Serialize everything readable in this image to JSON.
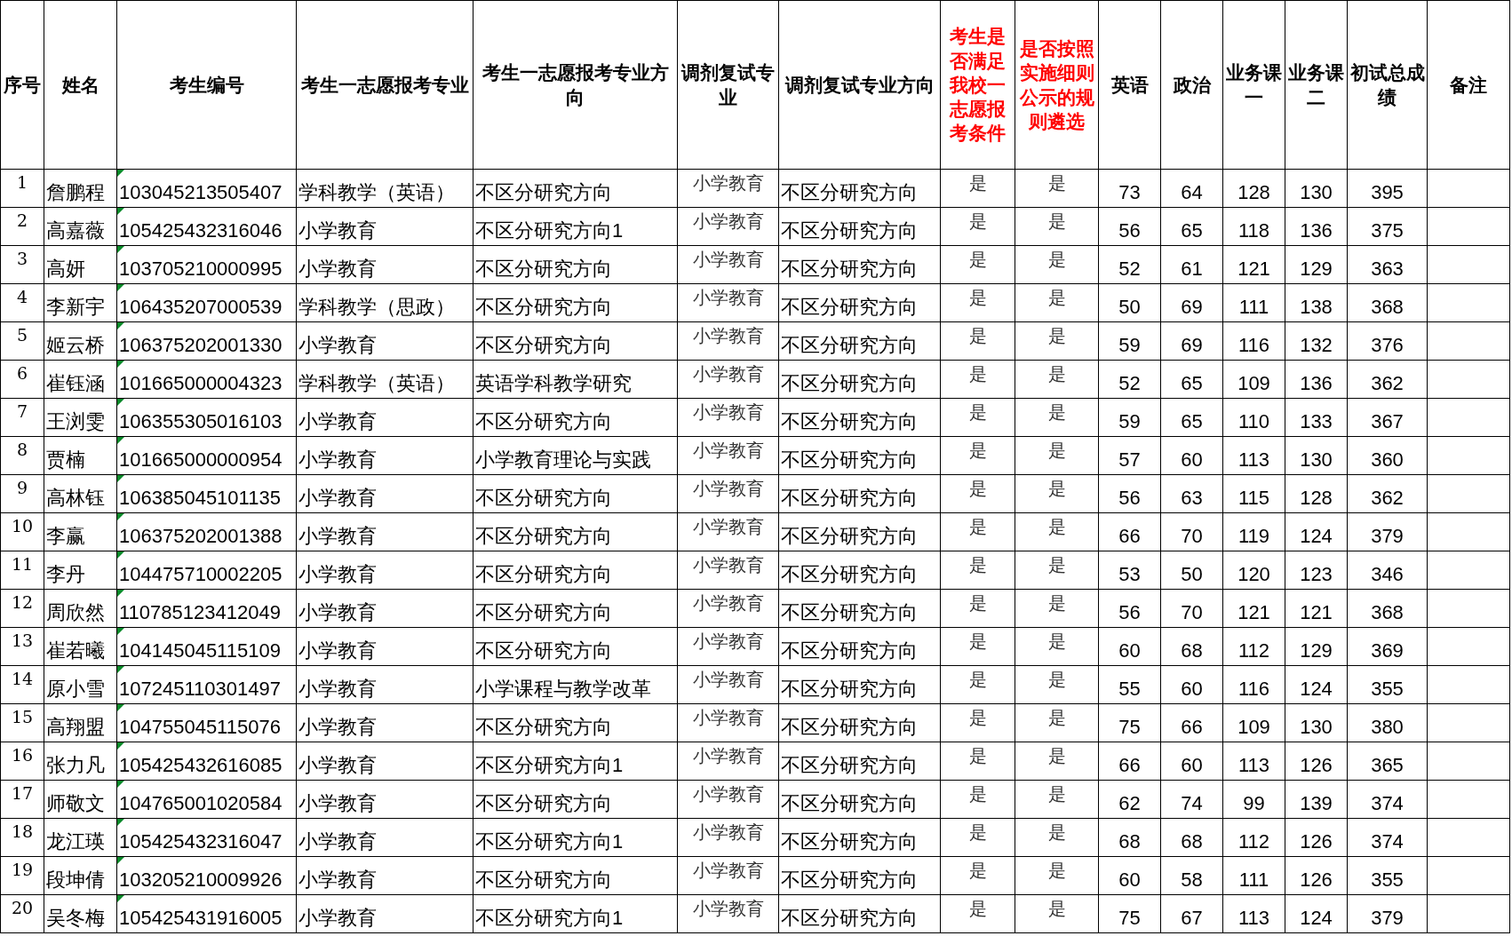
{
  "columns": [
    {
      "label": "序号",
      "color": "#000000"
    },
    {
      "label": "姓名",
      "color": "#000000"
    },
    {
      "label": "考生编号",
      "color": "#000000"
    },
    {
      "label": "考生一志愿报考专业",
      "color": "#000000"
    },
    {
      "label": "考生一志愿报考专业方向",
      "color": "#000000"
    },
    {
      "label": "调剂复试专业",
      "color": "#000000"
    },
    {
      "label": "调剂复试专业方向",
      "color": "#000000"
    },
    {
      "label": "考生是否满足我校一志愿报考条件",
      "color": "#ff0000"
    },
    {
      "label": "是否按照实施细则公示的规则遴选",
      "color": "#ff0000"
    },
    {
      "label": "英语",
      "color": "#000000"
    },
    {
      "label": "政治",
      "color": "#000000"
    },
    {
      "label": "业务课一",
      "color": "#000000"
    },
    {
      "label": "业务课二",
      "color": "#000000"
    },
    {
      "label": "初试总成绩",
      "color": "#000000"
    },
    {
      "label": "备注",
      "color": "#000000"
    }
  ],
  "rows": [
    {
      "cells": [
        "1",
        "詹鹏程",
        "103045213505407",
        "学科教学（英语）",
        "不区分研究方向",
        "小学教育",
        "不区分研究方向",
        "是",
        "是",
        "73",
        "64",
        "128",
        "130",
        "395"
      ]
    },
    {
      "cells": [
        "2",
        "高嘉薇",
        "105425432316046",
        "小学教育",
        "不区分研究方向1",
        "小学教育",
        "不区分研究方向",
        "是",
        "是",
        "56",
        "65",
        "118",
        "136",
        "375"
      ]
    },
    {
      "cells": [
        "3",
        "高妍",
        "103705210000995",
        "小学教育",
        "不区分研究方向",
        "小学教育",
        "不区分研究方向",
        "是",
        "是",
        "52",
        "61",
        "121",
        "129",
        "363"
      ]
    },
    {
      "cells": [
        "4",
        "李新宇",
        "106435207000539",
        "学科教学（思政）",
        "不区分研究方向",
        "小学教育",
        "不区分研究方向",
        "是",
        "是",
        "50",
        "69",
        "111",
        "138",
        "368"
      ]
    },
    {
      "cells": [
        "5",
        "姬云桥",
        "106375202001330",
        "小学教育",
        "不区分研究方向",
        "小学教育",
        "不区分研究方向",
        "是",
        "是",
        "59",
        "69",
        "116",
        "132",
        "376"
      ]
    },
    {
      "cells": [
        "6",
        "崔钰涵",
        "101665000004323",
        "学科教学（英语）",
        "英语学科教学研究",
        "小学教育",
        "不区分研究方向",
        "是",
        "是",
        "52",
        "65",
        "109",
        "136",
        "362"
      ]
    },
    {
      "cells": [
        "7",
        "王浏雯",
        "106355305016103",
        "小学教育",
        "不区分研究方向",
        "小学教育",
        "不区分研究方向",
        "是",
        "是",
        "59",
        "65",
        "110",
        "133",
        "367"
      ]
    },
    {
      "cells": [
        "8",
        "贾楠",
        "101665000000954",
        "小学教育",
        "小学教育理论与实践",
        "小学教育",
        "不区分研究方向",
        "是",
        "是",
        "57",
        "60",
        "113",
        "130",
        "360"
      ]
    },
    {
      "cells": [
        "9",
        "高林钰",
        "106385045101135",
        "小学教育",
        "不区分研究方向",
        "小学教育",
        "不区分研究方向",
        "是",
        "是",
        "56",
        "63",
        "115",
        "128",
        "362"
      ]
    },
    {
      "cells": [
        "10",
        "李赢",
        "106375202001388",
        "小学教育",
        "不区分研究方向",
        "小学教育",
        "不区分研究方向",
        "是",
        "是",
        "66",
        "70",
        "119",
        "124",
        "379"
      ]
    },
    {
      "cells": [
        "11",
        "李丹",
        "104475710002205",
        "小学教育",
        "不区分研究方向",
        "小学教育",
        "不区分研究方向",
        "是",
        "是",
        "53",
        "50",
        "120",
        "123",
        "346"
      ]
    },
    {
      "cells": [
        "12",
        "周欣然",
        "110785123412049",
        "小学教育",
        "不区分研究方向",
        "小学教育",
        "不区分研究方向",
        "是",
        "是",
        "56",
        "70",
        "121",
        "121",
        "368"
      ]
    },
    {
      "cells": [
        "13",
        "崔若曦",
        "104145045115109",
        "小学教育",
        "不区分研究方向",
        "小学教育",
        "不区分研究方向",
        "是",
        "是",
        "60",
        "68",
        "112",
        "129",
        "369"
      ]
    },
    {
      "cells": [
        "14",
        "原小雪",
        "107245110301497",
        "小学教育",
        "小学课程与教学改革",
        "小学教育",
        "不区分研究方向",
        "是",
        "是",
        "55",
        "60",
        "116",
        "124",
        "355"
      ]
    },
    {
      "cells": [
        "15",
        "高翔盟",
        "104755045115076",
        "小学教育",
        "不区分研究方向",
        "小学教育",
        "不区分研究方向",
        "是",
        "是",
        "75",
        "66",
        "109",
        "130",
        "380"
      ]
    },
    {
      "cells": [
        "16",
        "张力凡",
        "105425432616085",
        "小学教育",
        "不区分研究方向1",
        "小学教育",
        "不区分研究方向",
        "是",
        "是",
        "66",
        "60",
        "113",
        "126",
        "365"
      ]
    },
    {
      "cells": [
        "17",
        "师敬文",
        "104765001020584",
        "小学教育",
        "不区分研究方向",
        "小学教育",
        "不区分研究方向",
        "是",
        "是",
        "62",
        "74",
        "99",
        "139",
        "374"
      ]
    },
    {
      "cells": [
        "18",
        "龙江瑛",
        "105425432316047",
        "小学教育",
        "不区分研究方向1",
        "小学教育",
        "不区分研究方向",
        "是",
        "是",
        "68",
        "68",
        "112",
        "126",
        "374"
      ]
    },
    {
      "cells": [
        "19",
        "段坤倩",
        "103205210009926",
        "小学教育",
        "不区分研究方向",
        "小学教育",
        "不区分研究方向",
        "是",
        "是",
        "60",
        "58",
        "111",
        "126",
        "355"
      ]
    },
    {
      "cells": [
        "20",
        "吴冬梅",
        "105425431916005",
        "小学教育",
        "不区分研究方向1",
        "小学教育",
        "不区分研究方向",
        "是",
        "是",
        "75",
        "67",
        "113",
        "124",
        "379"
      ]
    }
  ]
}
